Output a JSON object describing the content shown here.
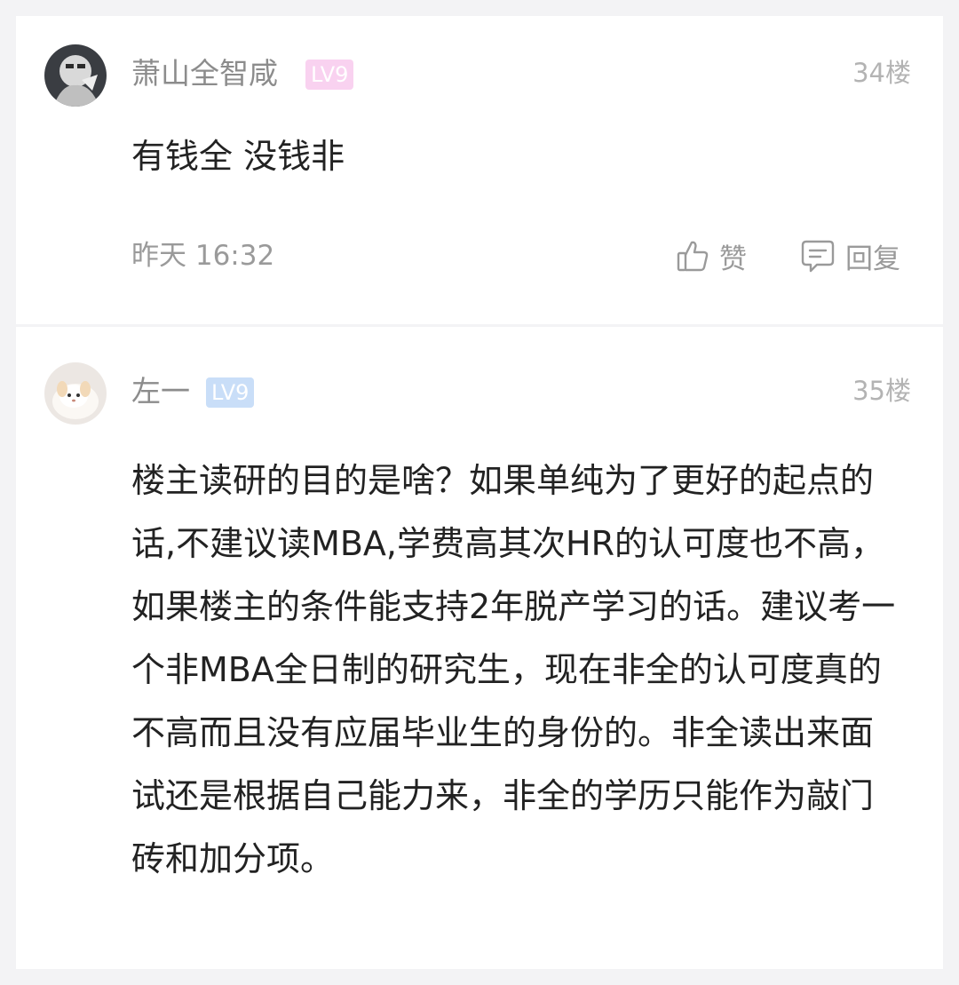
{
  "comments": [
    {
      "username": "萧山全智咸",
      "level": "LV9",
      "floor": "34楼",
      "content": "有钱全 没钱非",
      "time": "昨天 16:32",
      "like_label": "赞",
      "reply_label": "回复"
    },
    {
      "username": "左一",
      "level": "LV9",
      "floor": "35楼",
      "content": "楼主读研的目的是啥？如果单纯为了更好的起点的话,不建议读MBA,学费高其次HR的认可度也不高，如果楼主的条件能支持2年脱产学习的话。建议考一个非MBA全日制的研究生，现在非全的认可度真的不高而且没有应届毕业生的身份的。非全读出来面试还是根据自己能力来，非全的学历只能作为敲门砖和加分项。"
    }
  ],
  "icons": {
    "like": "thumbs-up-icon",
    "reply": "comment-bubble-icon"
  },
  "colors": {
    "background": "#f3f3f5",
    "card": "#ffffff",
    "level_pink": "#f9d2f0",
    "level_blue": "#c9def8"
  }
}
